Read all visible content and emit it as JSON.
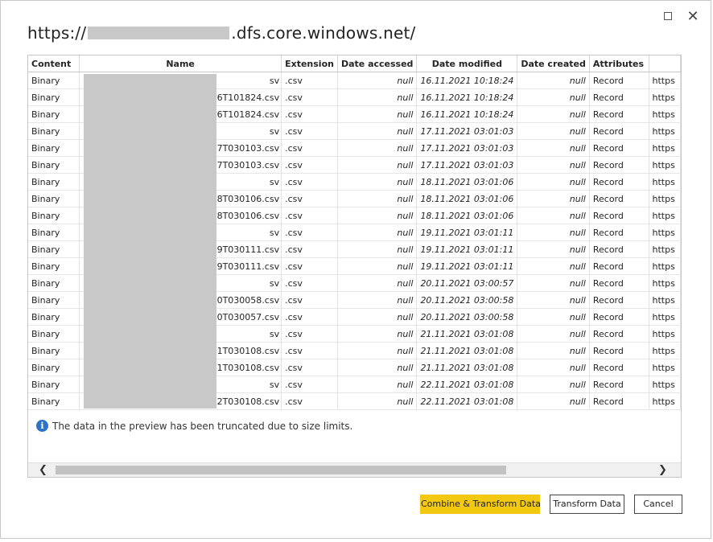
{
  "window": {
    "title_prefix": "https://",
    "title_suffix": ".dfs.core.windows.net/",
    "maximize_label": "",
    "close_label": "✕"
  },
  "columns": [
    "Content",
    "Name",
    "Extension",
    "Date accessed",
    "Date modified",
    "Date created",
    "Attributes",
    ""
  ],
  "rows": [
    [
      "Binary",
      "sv",
      ".csv",
      "null",
      "16.11.2021 10:18:24",
      "null",
      "Record",
      "https"
    ],
    [
      "Binary",
      "0211116T101824.csv",
      ".csv",
      "null",
      "16.11.2021 10:18:24",
      "null",
      "Record",
      "https"
    ],
    [
      "Binary",
      "116T101824.csv",
      ".csv",
      "null",
      "16.11.2021 10:18:24",
      "null",
      "Record",
      "https"
    ],
    [
      "Binary",
      "sv",
      ".csv",
      "null",
      "17.11.2021 03:01:03",
      "null",
      "Record",
      "https"
    ],
    [
      "Binary",
      "0211117T030103.csv",
      ".csv",
      "null",
      "17.11.2021 03:01:03",
      "null",
      "Record",
      "https"
    ],
    [
      "Binary",
      "117T030103.csv",
      ".csv",
      "null",
      "17.11.2021 03:01:03",
      "null",
      "Record",
      "https"
    ],
    [
      "Binary",
      "sv",
      ".csv",
      "null",
      "18.11.2021 03:01:06",
      "null",
      "Record",
      "https"
    ],
    [
      "Binary",
      "0211118T030106.csv",
      ".csv",
      "null",
      "18.11.2021 03:01:06",
      "null",
      "Record",
      "https"
    ],
    [
      "Binary",
      "118T030106.csv",
      ".csv",
      "null",
      "18.11.2021 03:01:06",
      "null",
      "Record",
      "https"
    ],
    [
      "Binary",
      "sv",
      ".csv",
      "null",
      "19.11.2021 03:01:11",
      "null",
      "Record",
      "https"
    ],
    [
      "Binary",
      "0211119T030111.csv",
      ".csv",
      "null",
      "19.11.2021 03:01:11",
      "null",
      "Record",
      "https"
    ],
    [
      "Binary",
      "119T030111.csv",
      ".csv",
      "null",
      "19.11.2021 03:01:11",
      "null",
      "Record",
      "https"
    ],
    [
      "Binary",
      "sv",
      ".csv",
      "null",
      "20.11.2021 03:00:57",
      "null",
      "Record",
      "https"
    ],
    [
      "Binary",
      "0211120T030058.csv",
      ".csv",
      "null",
      "20.11.2021 03:00:58",
      "null",
      "Record",
      "https"
    ],
    [
      "Binary",
      "120T030057.csv",
      ".csv",
      "null",
      "20.11.2021 03:00:58",
      "null",
      "Record",
      "https"
    ],
    [
      "Binary",
      "sv",
      ".csv",
      "null",
      "21.11.2021 03:01:08",
      "null",
      "Record",
      "https"
    ],
    [
      "Binary",
      "0211121T030108.csv",
      ".csv",
      "null",
      "21.11.2021 03:01:08",
      "null",
      "Record",
      "https"
    ],
    [
      "Binary",
      "121T030108.csv",
      ".csv",
      "null",
      "21.11.2021 03:01:08",
      "null",
      "Record",
      "https"
    ],
    [
      "Binary",
      "sv",
      ".csv",
      "null",
      "22.11.2021 03:01:08",
      "null",
      "Record",
      "https"
    ],
    [
      "Binary",
      "0211122T030108.csv",
      ".csv",
      "null",
      "22.11.2021 03:01:08",
      "null",
      "Record",
      "https"
    ]
  ],
  "notice": {
    "icon": "info-icon",
    "text": "The data in the preview has been truncated due to size limits."
  },
  "scrollbar": {
    "left_arrow": "❮",
    "right_arrow": "❯"
  },
  "buttons": {
    "combine": "Combine & Transform Data",
    "transform": "Transform Data",
    "cancel": "Cancel"
  },
  "colors": {
    "primary_button": "#f2c811",
    "info_icon": "#2c73c5",
    "redaction": "#c8c8c8"
  }
}
